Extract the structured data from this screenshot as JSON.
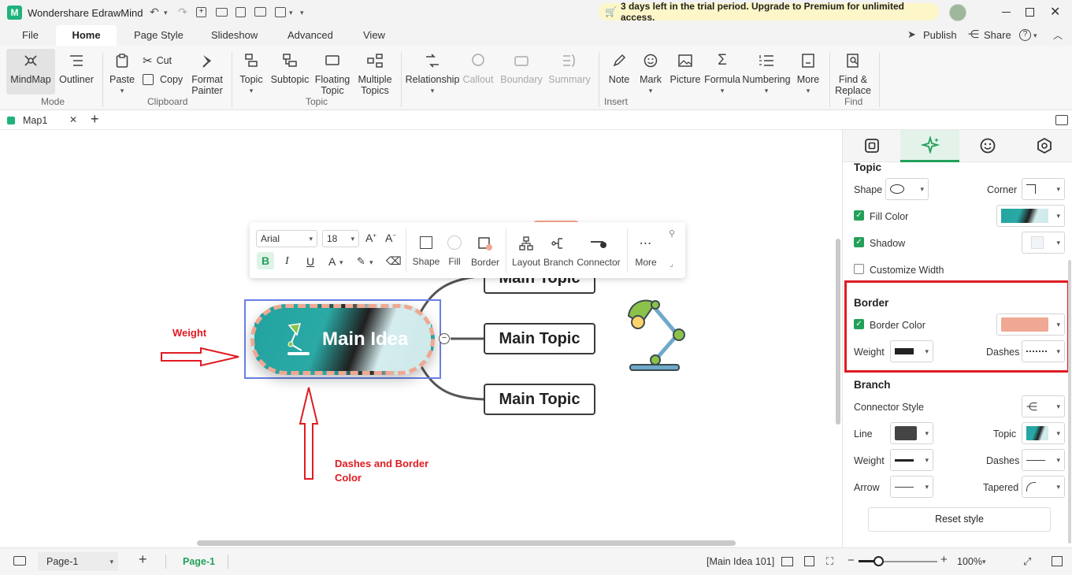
{
  "app": {
    "title": "Wondershare EdrawMind"
  },
  "trial": {
    "text": "3 days left in the trial period. Upgrade to Premium for unlimited access."
  },
  "menu": {
    "file": "File",
    "home": "Home",
    "page_style": "Page Style",
    "slideshow": "Slideshow",
    "advanced": "Advanced",
    "view": "View",
    "publish": "Publish",
    "share": "Share"
  },
  "ribbon": {
    "mindmap": "MindMap",
    "outliner": "Outliner",
    "mode": "Mode",
    "paste": "Paste",
    "cut": "Cut",
    "copy": "Copy",
    "format_painter_1": "Format",
    "format_painter_2": "Painter",
    "clipboard": "Clipboard",
    "topic": "Topic",
    "subtopic": "Subtopic",
    "floating_1": "Floating",
    "floating_2": "Topic",
    "multiple_1": "Multiple",
    "multiple_2": "Topics",
    "topic_group": "Topic",
    "relationship": "Relationship",
    "callout": "Callout",
    "boundary": "Boundary",
    "summary": "Summary",
    "note": "Note",
    "mark": "Mark",
    "picture": "Picture",
    "formula": "Formula",
    "numbering": "Numbering",
    "more": "More",
    "insert": "Insert",
    "find_1": "Find &",
    "find_2": "Replace",
    "find": "Find"
  },
  "tabs": {
    "doc": "Map1"
  },
  "floating_toolbar": {
    "font": "Arial",
    "size": "18",
    "bold": "B",
    "italic": "I",
    "underline": "U",
    "font_color": "A",
    "shape": "Shape",
    "fill": "Fill",
    "border": "Border",
    "layout": "Layout",
    "branch": "Branch",
    "connector": "Connector",
    "more": "More"
  },
  "map": {
    "main_idea": "Main Idea",
    "topic1": "Main Topic",
    "topic2": "Main Topic",
    "topic3": "Main Topic"
  },
  "annotations": {
    "weight": "Weight",
    "dashes_1": "Dashes and Border",
    "dashes_2": "Color"
  },
  "panel": {
    "topic_head": "Topic",
    "shape": "Shape",
    "corner": "Corner",
    "fill_color": "Fill Color",
    "shadow": "Shadow",
    "customize_width": "Customize Width",
    "border_head": "Border",
    "border_color": "Border Color",
    "weight": "Weight",
    "dashes": "Dashes",
    "branch_head": "Branch",
    "connector_style": "Connector Style",
    "line": "Line",
    "topic": "Topic",
    "b_weight": "Weight",
    "b_dashes": "Dashes",
    "arrow": "Arrow",
    "tapered": "Tapered",
    "reset": "Reset style"
  },
  "status": {
    "page_select": "Page-1",
    "page_tab": "Page-1",
    "selection": "[Main Idea 101]",
    "zoom": "100%"
  },
  "colors": {
    "accent": "#23a05a",
    "border_color": "#efa893",
    "highlight": "#e01b22",
    "trial_bg": "#fdf6c8",
    "selection": "#6a7fe6"
  }
}
